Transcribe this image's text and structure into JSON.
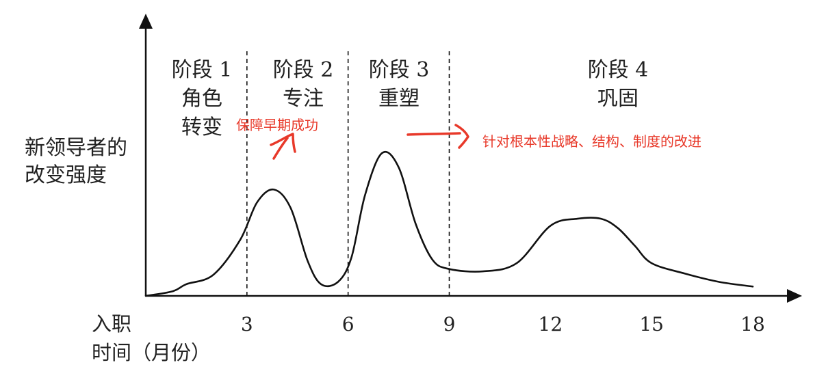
{
  "chart_data": {
    "type": "line",
    "ylabel_lines": [
      "新领导者的",
      "改变强度"
    ],
    "xlabel_top": "入职",
    "xlabel_bottom": "时间（月份）",
    "xlim": [
      0,
      18
    ],
    "ticks": [
      "3",
      "6",
      "9",
      "12",
      "15",
      "18"
    ],
    "stage_boundaries": [
      3,
      6,
      9
    ],
    "stages": [
      {
        "title": "阶段 1",
        "lines": [
          "角色",
          "转变"
        ]
      },
      {
        "title": "阶段 2",
        "lines": [
          "专注"
        ]
      },
      {
        "title": "阶段 3",
        "lines": [
          "重塑"
        ]
      },
      {
        "title": "阶段 4",
        "lines": [
          "巩固"
        ]
      }
    ],
    "annotations": [
      {
        "text": "保障早期成功",
        "color": "#e8392a"
      },
      {
        "text": "针对根本性战略、结构、制度的改进",
        "color": "#e8392a"
      }
    ],
    "curve": {
      "x": [
        0,
        0.8,
        1.2,
        2.0,
        2.8,
        3.3,
        3.8,
        4.3,
        4.8,
        5.2,
        5.7,
        6.1,
        6.5,
        7.0,
        7.5,
        8.0,
        8.5,
        9.0,
        10.0,
        11.0,
        12.0,
        12.8,
        13.5,
        14.0,
        14.5,
        15.0,
        16.0,
        17.0,
        18.0
      ],
      "y": [
        0.0,
        0.4,
        1.0,
        1.8,
        4.8,
        8.0,
        9.1,
        7.5,
        3.0,
        1.0,
        1.2,
        3.3,
        8.6,
        12.2,
        11.0,
        6.2,
        3.1,
        2.3,
        2.1,
        2.8,
        6.0,
        6.6,
        6.6,
        5.8,
        4.3,
        2.8,
        1.9,
        1.2,
        0.8
      ]
    },
    "ylim": [
      0,
      14.5
    ],
    "colors": {
      "curve": "#111111",
      "axis": "#111111",
      "note": "#e8392a"
    }
  }
}
